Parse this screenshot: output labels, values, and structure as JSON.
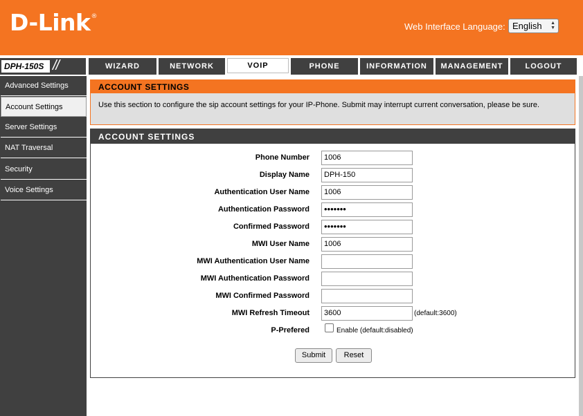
{
  "header": {
    "logo": "D-Link",
    "logo_mark": "®",
    "lang_label": "Web Interface Language:",
    "lang_value": "English"
  },
  "model": {
    "name": "DPH-150S",
    "slashes": "//"
  },
  "tabs": [
    "WIZARD",
    "NETWORK",
    "VOIP",
    "PHONE",
    "INFORMATION",
    "MANAGEMENT",
    "LOGOUT"
  ],
  "sidebar": {
    "items": [
      "Advanced Settings",
      "Account Settings",
      "Server Settings",
      "NAT Traversal",
      "Security",
      "Voice Settings"
    ]
  },
  "info": {
    "title": "ACCOUNT SETTINGS",
    "text": "Use this section to configure the sip account settings for your IP-Phone. Submit may interrupt current conversation, please be sure."
  },
  "form": {
    "title": "ACCOUNT SETTINGS",
    "fields": [
      {
        "label": "Phone Number",
        "value": "1006"
      },
      {
        "label": "Display Name",
        "value": "DPH-150"
      },
      {
        "label": "Authentication User Name",
        "value": "1006"
      },
      {
        "label": "Authentication Password",
        "value": "•••••••"
      },
      {
        "label": "Confirmed Password",
        "value": "•••••••"
      },
      {
        "label": "MWI User Name",
        "value": "1006"
      },
      {
        "label": "MWI Authentication User Name",
        "value": ""
      },
      {
        "label": "MWI Authentication Password",
        "value": ""
      },
      {
        "label": "MWI Confirmed Password",
        "value": ""
      },
      {
        "label": "MWI Refresh Timeout",
        "value": "3600",
        "hint": "(default:3600)"
      }
    ],
    "pref": {
      "label": "P-Prefered",
      "checkbox_label": "Enable (default:disabled)",
      "checked": false
    },
    "submit": "Submit",
    "reset": "Reset"
  }
}
